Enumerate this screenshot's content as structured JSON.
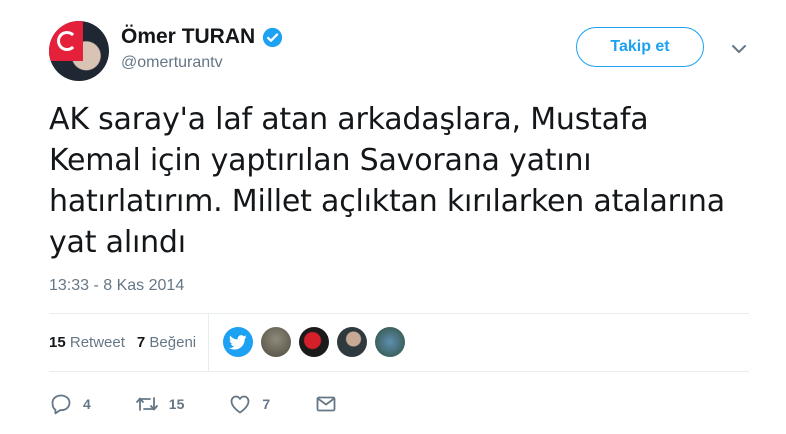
{
  "user": {
    "display_name": "Ömer TURAN",
    "handle": "@omerturantv",
    "verified": true
  },
  "follow_button_label": "Takip et",
  "tweet": {
    "line1": "AK saray'a laf atan arkadaşlara, Mustafa",
    "line2": "Kemal için yaptırılan Savorana yatını",
    "line3": "hatırlatırım. Millet açlıktan kırılarken atalarına",
    "line4": "yat alındı",
    "timestamp": "13:33 - 8 Kas 2014"
  },
  "stats": {
    "retweet_count": "15",
    "retweet_label": "Retweet",
    "like_count": "7",
    "like_label": "Beğeni"
  },
  "actions": {
    "reply_count": "4",
    "retweet_count": "15",
    "like_count": "7"
  },
  "colors": {
    "accent": "#1da1f2",
    "secondary_text": "#657786",
    "divider": "#e6ecf0"
  },
  "icons": [
    "verified-badge-icon",
    "chevron-down-icon",
    "twitter-bird-icon",
    "reply-icon",
    "retweet-icon",
    "heart-icon",
    "envelope-icon"
  ]
}
